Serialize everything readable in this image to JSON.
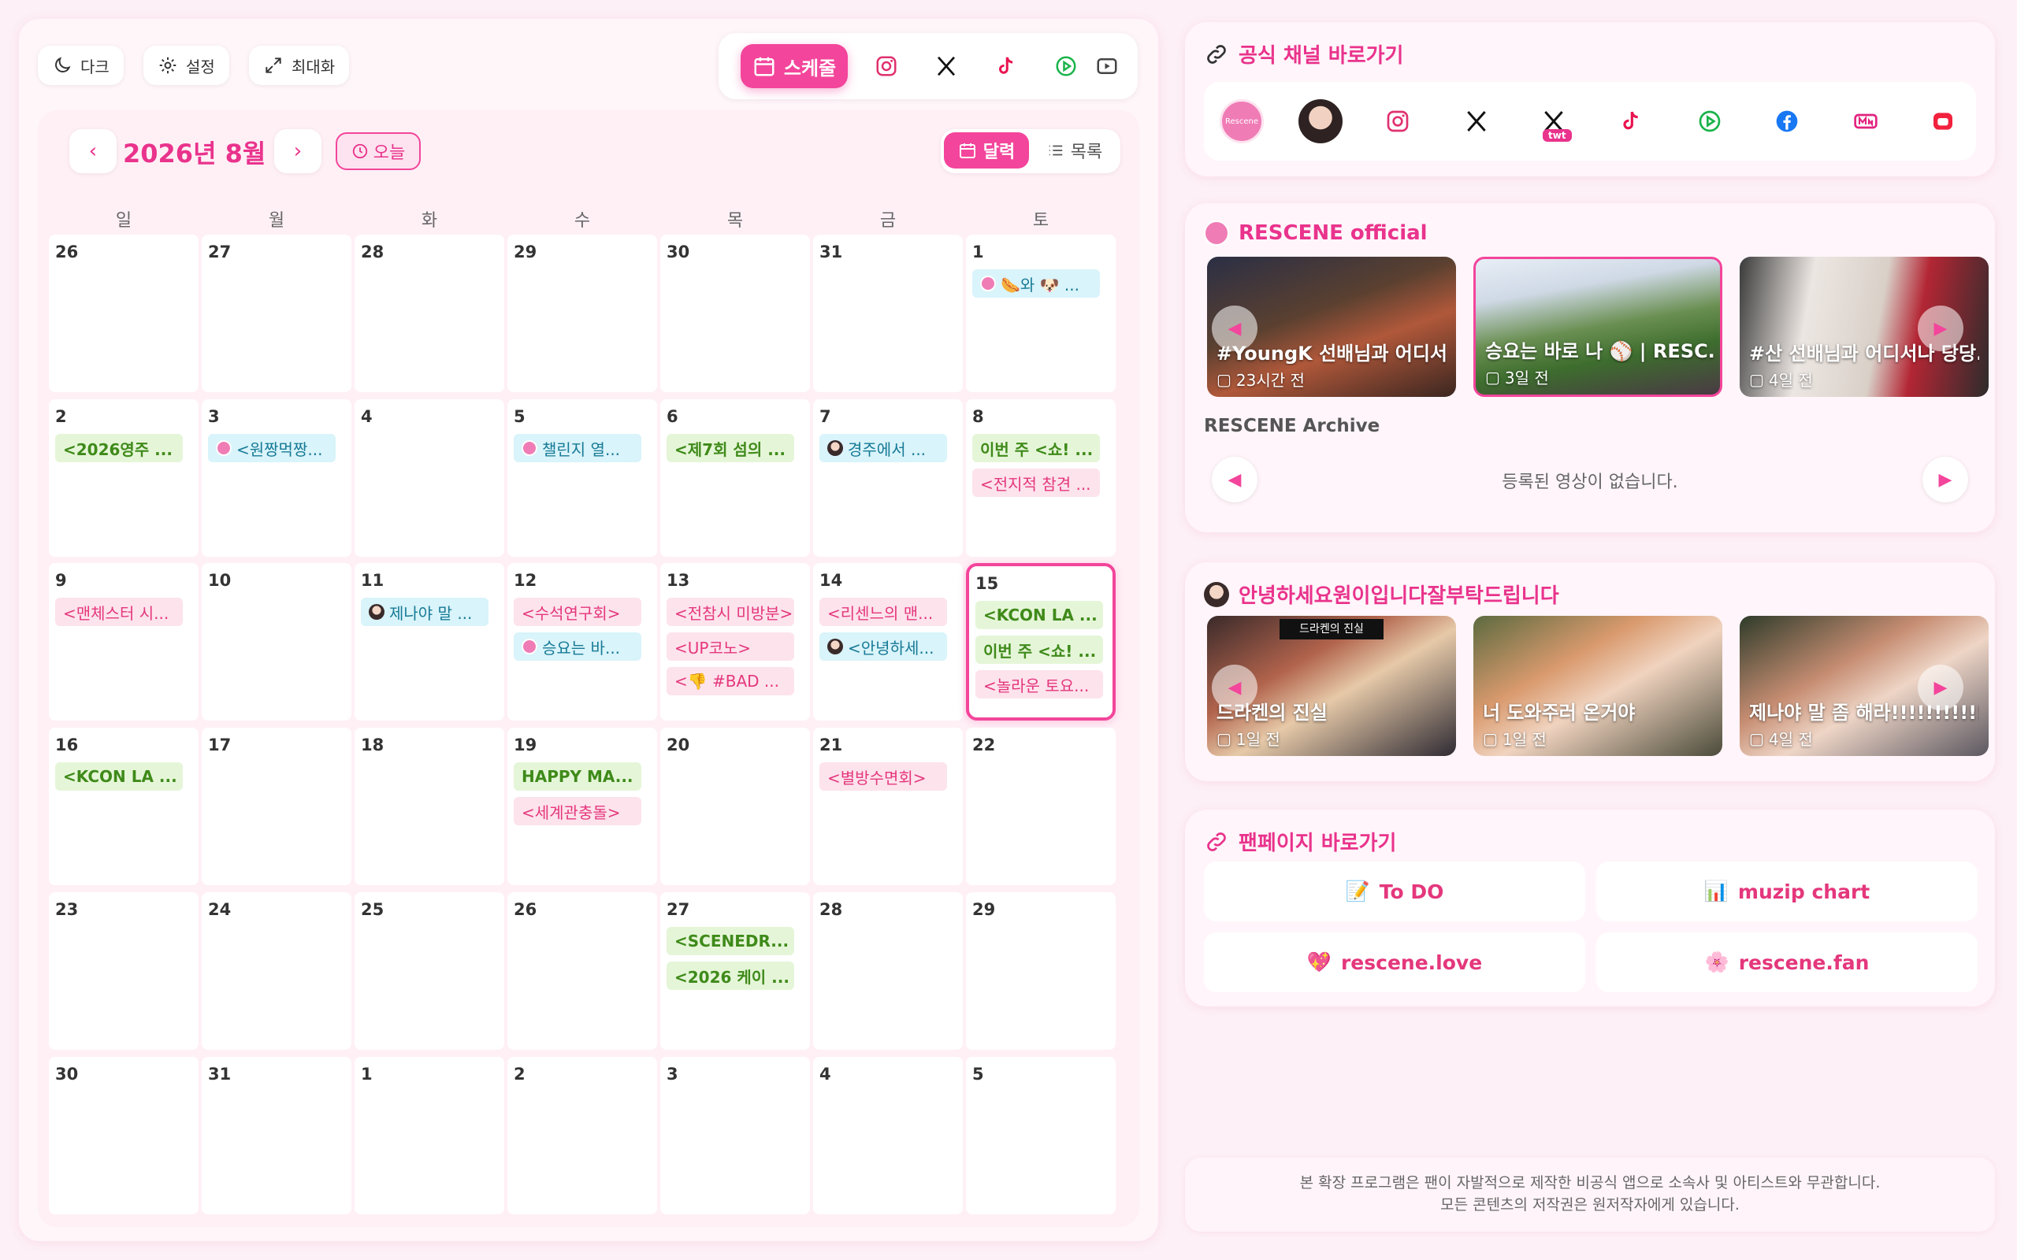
{
  "toolbar": {
    "dark_label": "다크",
    "settings_label": "설정",
    "maximize_label": "최대화",
    "schedule_tab_label": "스케줄"
  },
  "calendar": {
    "month_title": "2026년 8월",
    "today_label": "오늘",
    "view_calendar_label": "달력",
    "view_list_label": "목록",
    "weekdays": [
      "일",
      "월",
      "화",
      "수",
      "목",
      "금",
      "토"
    ],
    "weeks": [
      [
        {
          "d": "26"
        },
        {
          "d": "27"
        },
        {
          "d": "28"
        },
        {
          "d": "29"
        },
        {
          "d": "30"
        },
        {
          "d": "31"
        },
        {
          "d": "1",
          "events": [
            {
              "t": "🌭와 🐶 ...",
              "c": "cyan",
              "icon": "logo"
            }
          ]
        }
      ],
      [
        {
          "d": "2",
          "events": [
            {
              "t": "<2026영주 ...",
              "c": "green"
            }
          ]
        },
        {
          "d": "3",
          "events": [
            {
              "t": "<원짱먹짱...",
              "c": "cyan",
              "icon": "logo"
            }
          ]
        },
        {
          "d": "4"
        },
        {
          "d": "5",
          "events": [
            {
              "t": "챌린지 열...",
              "c": "cyan",
              "icon": "logo"
            }
          ]
        },
        {
          "d": "6",
          "events": [
            {
              "t": "<제7회 섬의 ...",
              "c": "green"
            }
          ]
        },
        {
          "d": "7",
          "events": [
            {
              "t": "경주에서 ...",
              "c": "cyan",
              "icon": "person"
            }
          ]
        },
        {
          "d": "8",
          "events": [
            {
              "t": "이번 주 <쇼! ...",
              "c": "green"
            },
            {
              "t": "<전지적 참견 ...",
              "c": "pink"
            }
          ]
        }
      ],
      [
        {
          "d": "9",
          "events": [
            {
              "t": "<맨체스터 시...",
              "c": "pink"
            }
          ]
        },
        {
          "d": "10"
        },
        {
          "d": "11",
          "events": [
            {
              "t": "제나야 말 ...",
              "c": "cyan",
              "icon": "person"
            }
          ]
        },
        {
          "d": "12",
          "events": [
            {
              "t": "<수석연구회>",
              "c": "pink"
            },
            {
              "t": "승요는 바...",
              "c": "cyan",
              "icon": "logo"
            }
          ]
        },
        {
          "d": "13",
          "events": [
            {
              "t": "<전참시 미방분>",
              "c": "pink"
            },
            {
              "t": "<UP코노>",
              "c": "pink"
            },
            {
              "t": "<👎 #BAD ...",
              "c": "pink"
            }
          ]
        },
        {
          "d": "14",
          "events": [
            {
              "t": "<리센느의 맨...",
              "c": "pink"
            },
            {
              "t": "<안녕하세...",
              "c": "cyan",
              "icon": "person"
            }
          ]
        },
        {
          "d": "15",
          "today": true,
          "events": [
            {
              "t": "<KCON LA ...",
              "c": "green"
            },
            {
              "t": "이번 주 <쇼! ...",
              "c": "green"
            },
            {
              "t": "<놀라운 토요...",
              "c": "pink"
            }
          ]
        }
      ],
      [
        {
          "d": "16",
          "events": [
            {
              "t": "<KCON LA ...",
              "c": "green"
            }
          ]
        },
        {
          "d": "17"
        },
        {
          "d": "18"
        },
        {
          "d": "19",
          "events": [
            {
              "t": "HAPPY MA...",
              "c": "green"
            },
            {
              "t": "<세계관충돌>",
              "c": "pink"
            }
          ]
        },
        {
          "d": "20"
        },
        {
          "d": "21",
          "events": [
            {
              "t": "<별방수면회>",
              "c": "pink"
            }
          ]
        },
        {
          "d": "22"
        }
      ],
      [
        {
          "d": "23"
        },
        {
          "d": "24"
        },
        {
          "d": "25"
        },
        {
          "d": "26"
        },
        {
          "d": "27",
          "events": [
            {
              "t": "<SCENEDR...",
              "c": "green"
            },
            {
              "t": "<2026 케이 ...",
              "c": "green"
            }
          ]
        },
        {
          "d": "28"
        },
        {
          "d": "29"
        }
      ],
      [
        {
          "d": "30"
        },
        {
          "d": "31"
        },
        {
          "d": "1"
        },
        {
          "d": "2"
        },
        {
          "d": "3"
        },
        {
          "d": "4"
        },
        {
          "d": "5"
        }
      ]
    ]
  },
  "official_channels": {
    "title": "공식 채널 바로가기",
    "twt_badge": "twt",
    "logo_text": "Rescene"
  },
  "rescene_official": {
    "title": "RESCENE official",
    "videos": [
      {
        "title": "#YoungK 선배님과 어디서...",
        "date": "23시간 전"
      },
      {
        "title": "승요는 바로 나 ⚾ | RESC...",
        "date": "3일 전"
      },
      {
        "title": "#산 선배님과 어디서나 당당...",
        "date": "4일 전"
      }
    ],
    "archive_title": "RESCENE Archive",
    "archive_empty": "등록된 영상이 없습니다."
  },
  "member_channel": {
    "title": "안녕하세요원이입니다잘부탁드립니다",
    "videos": [
      {
        "title": "드라켄의 진실",
        "date": "1일 전",
        "caption": "드라켄의 진실"
      },
      {
        "title": "너 도와주러 온거야",
        "date": "1일 전"
      },
      {
        "title": "제나야 말 좀 해라!!!!!!!!!!!!!!",
        "date": "4일 전"
      }
    ]
  },
  "fan_pages": {
    "title": "팬페이지 바로가기",
    "buttons": [
      {
        "label": "To DO",
        "emoji": "📝"
      },
      {
        "label": "muzip chart",
        "emoji": "📊"
      },
      {
        "label": "rescene.love",
        "emoji": "💖"
      },
      {
        "label": "rescene.fan",
        "emoji": "🌸"
      }
    ]
  },
  "footer": {
    "line1": "본 확장 프로그램은 팬이 자발적으로 제작한 비공식 앱으로 소속사 및 아티스트와 무관합니다.",
    "line2": "모든 콘텐츠의 저작권은 원저작자에게 있습니다."
  },
  "colors": {
    "accent": "#f3459b",
    "accent_text": "#e9338c",
    "event_green_bg": "#e5f6d8",
    "event_pink_bg": "#fde3ec",
    "event_cyan_bg": "#d9f4fa"
  }
}
